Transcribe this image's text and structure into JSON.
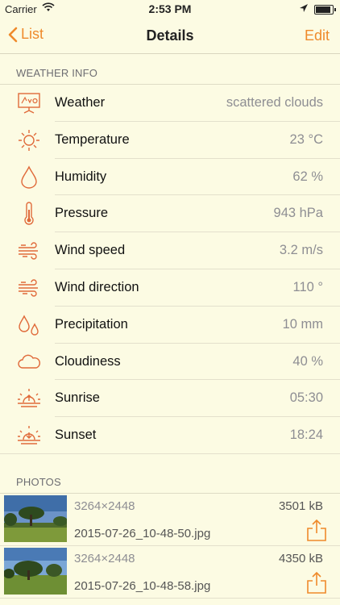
{
  "status_bar": {
    "carrier": "Carrier",
    "time": "2:53 PM"
  },
  "nav": {
    "back_label": "List",
    "title": "Details",
    "edit_label": "Edit"
  },
  "accent_color": "#ef8a2b",
  "weather_section": {
    "header": "WEATHER INFO",
    "rows": [
      {
        "icon": "weather-board-icon",
        "label": "Weather",
        "value": "scattered clouds"
      },
      {
        "icon": "sun-icon",
        "label": "Temperature",
        "value": "23 °C"
      },
      {
        "icon": "drop-icon",
        "label": "Humidity",
        "value": "62 %"
      },
      {
        "icon": "thermometer-icon",
        "label": "Pressure",
        "value": "943 hPa"
      },
      {
        "icon": "wind-icon",
        "label": "Wind speed",
        "value": "3.2 m/s"
      },
      {
        "icon": "wind-icon",
        "label": "Wind direction",
        "value": "110 °"
      },
      {
        "icon": "rain-drops-icon",
        "label": "Precipitation",
        "value": "10 mm"
      },
      {
        "icon": "cloud-icon",
        "label": "Cloudiness",
        "value": "40 %"
      },
      {
        "icon": "sunrise-icon",
        "label": "Sunrise",
        "value": "05:30"
      },
      {
        "icon": "sunset-icon",
        "label": "Sunset",
        "value": "18:24"
      }
    ]
  },
  "photos_section": {
    "header": "PHOTOS",
    "items": [
      {
        "dimensions": "3264×2448",
        "size": "3501 kB",
        "filename": "2015-07-26_10-48-50.jpg"
      },
      {
        "dimensions": "3264×2448",
        "size": "4350 kB",
        "filename": "2015-07-26_10-48-58.jpg"
      }
    ]
  }
}
